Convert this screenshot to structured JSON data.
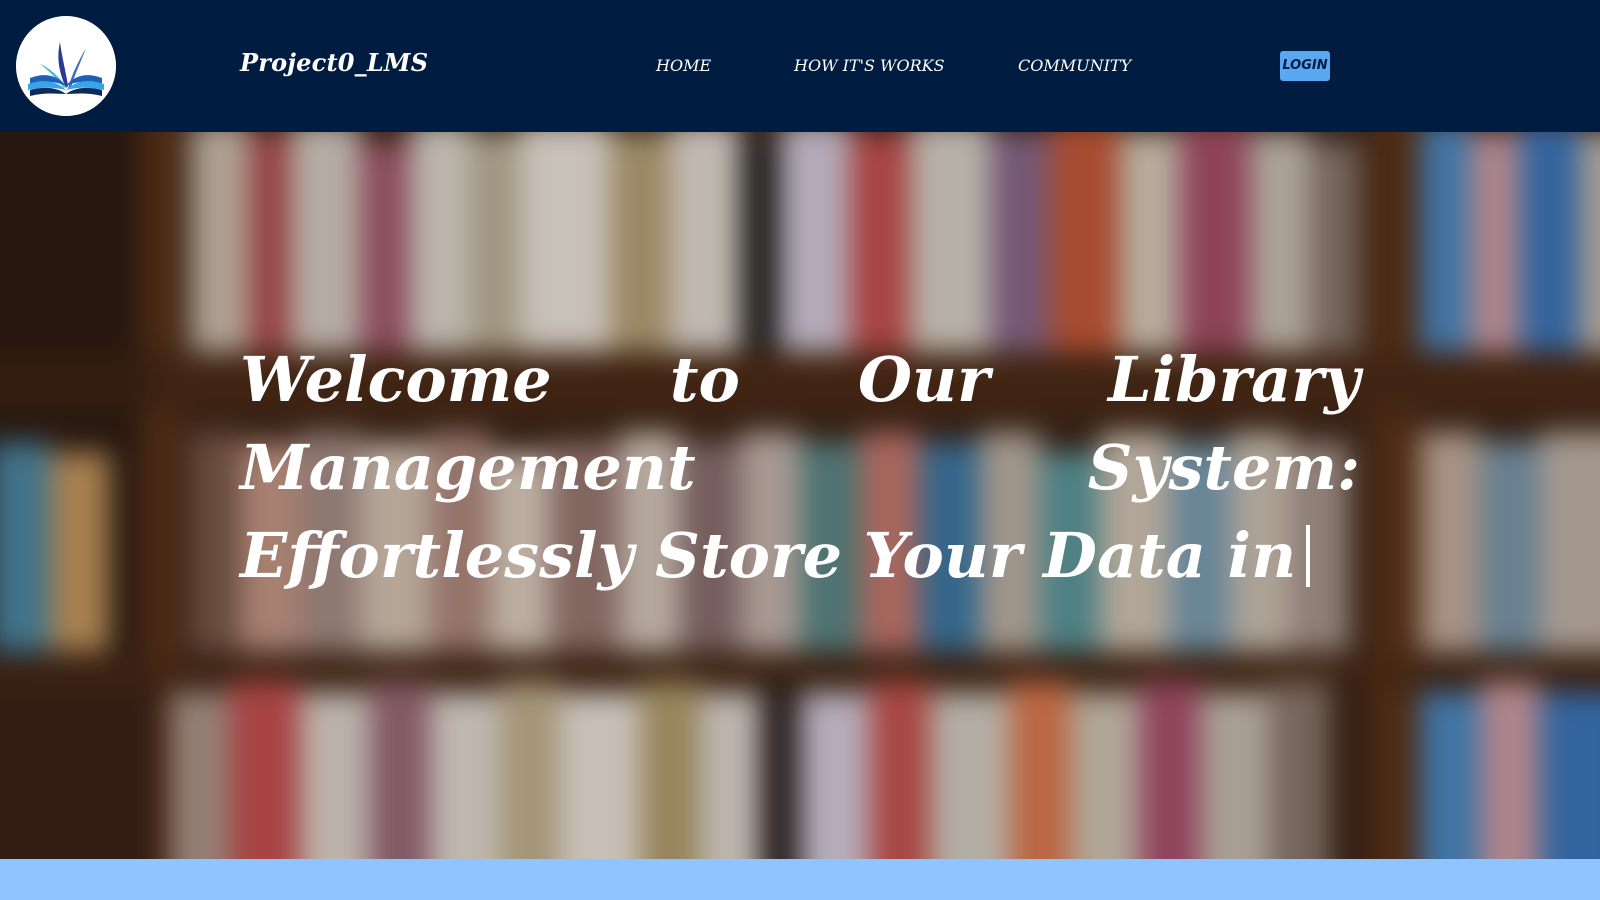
{
  "header": {
    "brand": "Project0_LMS",
    "logo_icon": "open-book-logo-icon",
    "nav": {
      "home": "HOME",
      "how_it_works": "HOW IT'S WORKS",
      "community": "COMMUNITY"
    },
    "login_label": "LOGIN"
  },
  "hero": {
    "title": "Welcome to Our Library Management System: Effortlessly Store Your Data in"
  },
  "colors": {
    "navbar_bg": "#001c40",
    "login_bg": "#5aa7f2",
    "bottom_band": "#8ec5ff",
    "text": "#ffffff"
  }
}
